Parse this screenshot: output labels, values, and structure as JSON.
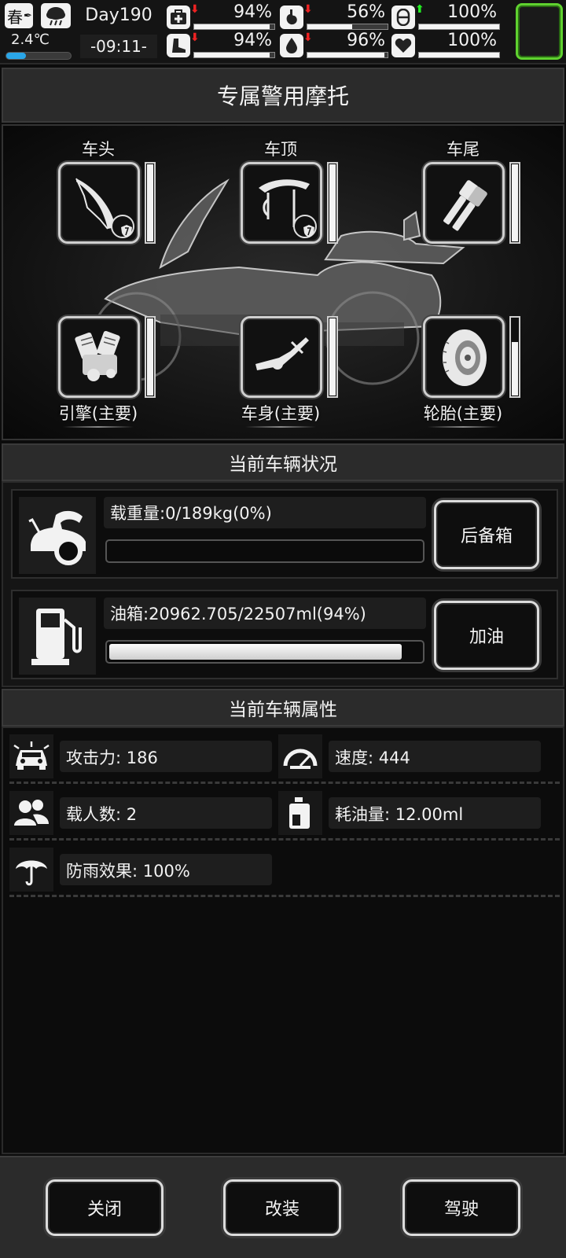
{
  "status_bar": {
    "season": "春",
    "temperature": "2.4℃",
    "temperature_level": 0.3,
    "day": "Day190",
    "time": "-09:11-",
    "stats": [
      {
        "name": "health",
        "icon": "medkit-icon",
        "arrow": "down",
        "value": "94%",
        "level": 0.94
      },
      {
        "name": "hunger",
        "icon": "stomach-icon",
        "arrow": "down",
        "value": "56%",
        "level": 0.56
      },
      {
        "name": "mood",
        "icon": "pill-icon",
        "arrow": "up",
        "value": "100%",
        "level": 1.0
      },
      {
        "name": "stamina",
        "icon": "boot-icon",
        "arrow": "down",
        "value": "94%",
        "level": 0.94
      },
      {
        "name": "thirst",
        "icon": "water-drop-icon",
        "arrow": "down",
        "value": "96%",
        "level": 0.96
      },
      {
        "name": "heart",
        "icon": "heart-icon",
        "arrow": "none",
        "value": "100%",
        "level": 1.0
      }
    ],
    "accent_color": "#5fd22f"
  },
  "title": "专属警用摩托",
  "slots": {
    "head": {
      "label": "车头",
      "durability": 1.0
    },
    "top": {
      "label": "车顶",
      "durability": 1.0
    },
    "tail": {
      "label": "车尾",
      "durability": 1.0
    },
    "engine": {
      "label": "引擎(主要)",
      "durability": 1.0
    },
    "body": {
      "label": "车身(主要)",
      "durability": 1.0
    },
    "tire": {
      "label": "轮胎(主要)",
      "durability": 0.7
    }
  },
  "status_section": {
    "header": "当前车辆状况",
    "load": {
      "label": "载重量:0/189kg(0%)",
      "level": 0.0,
      "button": "后备箱"
    },
    "fuel": {
      "label": "油箱:20962.705/22507ml(94%)",
      "level": 0.94,
      "button": "加油"
    }
  },
  "attr_section": {
    "header": "当前车辆属性",
    "attack": "攻击力: 186",
    "speed": "速度: 444",
    "passengers": "载人数: 2",
    "fuel_use": "耗油量: 12.00ml",
    "rain_protect": "防雨效果: 100%"
  },
  "bottom": {
    "close": "关闭",
    "modify": "改装",
    "drive": "驾驶"
  }
}
